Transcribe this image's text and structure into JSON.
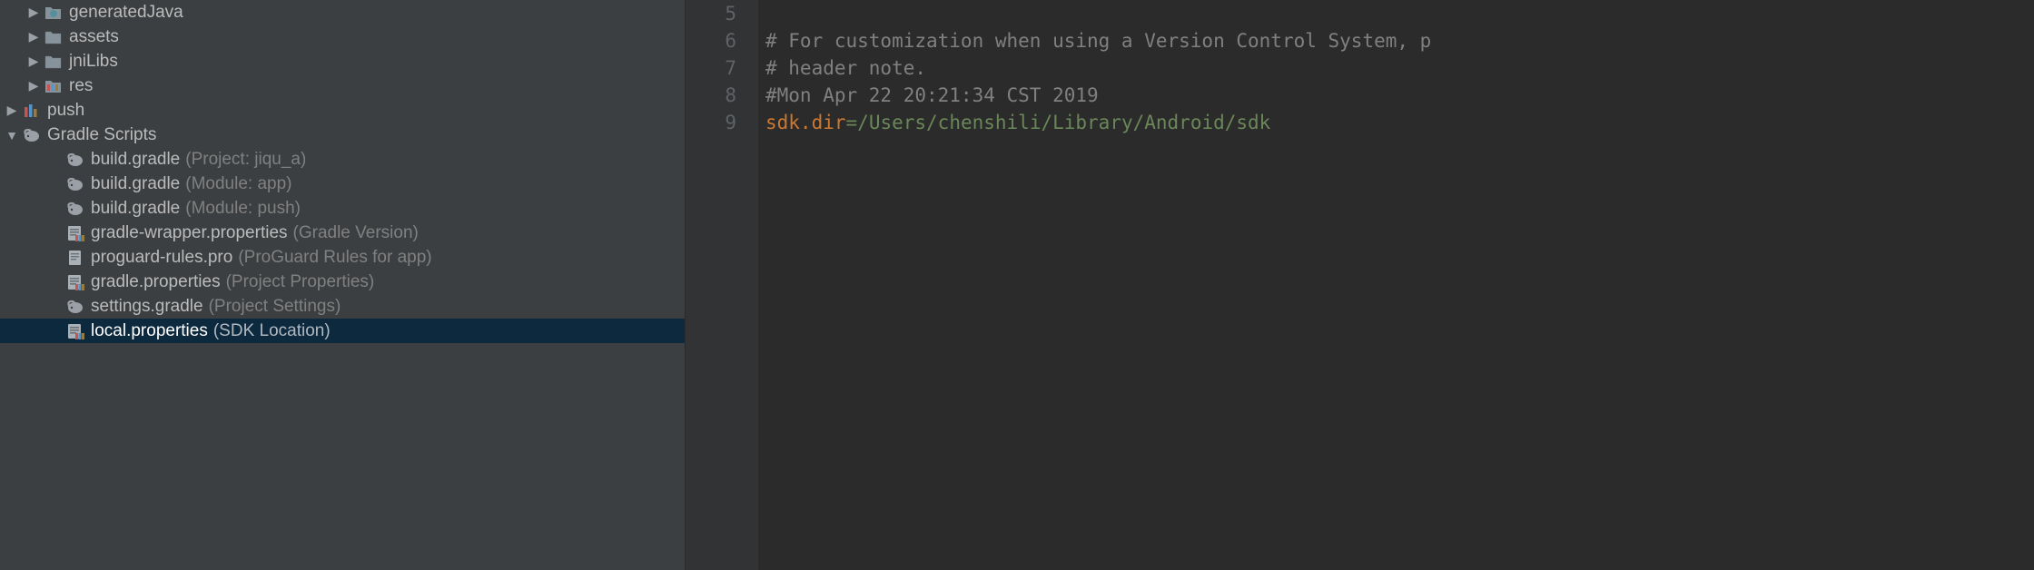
{
  "tree": {
    "generatedJava": {
      "label": "generatedJava"
    },
    "assets": {
      "label": "assets"
    },
    "jniLibs": {
      "label": "jniLibs"
    },
    "res": {
      "label": "res"
    },
    "push": {
      "label": "push"
    },
    "gradleScripts": {
      "label": "Gradle Scripts"
    },
    "buildGradleProject": {
      "label": "build.gradle",
      "hint": "(Project: jiqu_a)"
    },
    "buildGradleApp": {
      "label": "build.gradle",
      "hint": "(Module: app)"
    },
    "buildGradlePush": {
      "label": "build.gradle",
      "hint": "(Module: push)"
    },
    "gradleWrapper": {
      "label": "gradle-wrapper.properties",
      "hint": "(Gradle Version)"
    },
    "proguard": {
      "label": "proguard-rules.pro",
      "hint": "(ProGuard Rules for app)"
    },
    "gradleProps": {
      "label": "gradle.properties",
      "hint": "(Project Properties)"
    },
    "settingsGradle": {
      "label": "settings.gradle",
      "hint": "(Project Settings)"
    },
    "localProps": {
      "label": "local.properties",
      "hint": "(SDK Location)"
    }
  },
  "editor": {
    "lines": {
      "l5": "# For customization when using a Version Control System, p",
      "l6": "# header note.",
      "l7": "#Mon Apr 22 20:21:34 CST 2019",
      "l8key": "sdk.dir",
      "l8sep": "=",
      "l8val": "/Users/chenshili/Library/Android/sdk"
    },
    "gutter": {
      "n5": "5",
      "n6": "6",
      "n7": "7",
      "n8": "8",
      "n9": "9"
    }
  }
}
